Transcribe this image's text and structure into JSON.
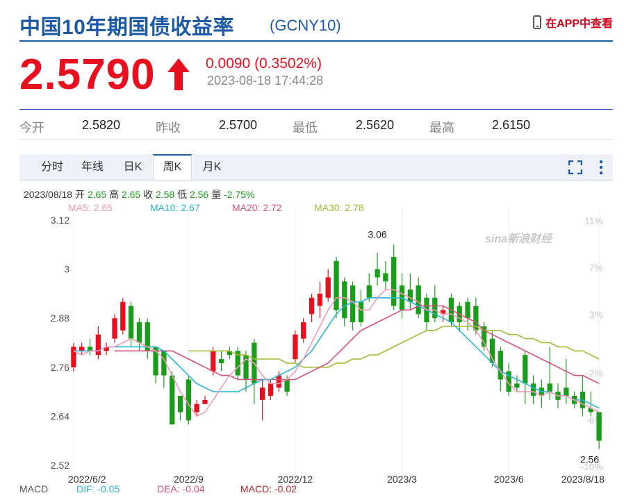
{
  "header": {
    "title": "中国10年期国债收益率",
    "code": "(GCNY10)",
    "app_link": "在APP中查看"
  },
  "quote": {
    "price": "2.5790",
    "change": "0.0090 (0.3502%)",
    "time": "2023-08-18 17:44:28"
  },
  "stats": [
    {
      "label": "今开",
      "value": "2.5820"
    },
    {
      "label": "昨收",
      "value": "2.5700"
    },
    {
      "label": "最低",
      "value": "2.5620"
    },
    {
      "label": "最高",
      "value": "2.6150"
    }
  ],
  "tabs": [
    {
      "label": "分时"
    },
    {
      "label": "年线"
    },
    {
      "label": "日K"
    },
    {
      "label": "周K",
      "active": true
    },
    {
      "label": "月K"
    }
  ],
  "info": {
    "date": "2023/08/18",
    "open_label": "开",
    "open": "2.65",
    "high_label": "高",
    "high": "2.65",
    "close_label": "收",
    "close": "2.58",
    "low_label": "低",
    "low": "2.56",
    "vol_label": "量",
    "change": "-2.75%"
  },
  "ma_legend": [
    {
      "text": "MA5: 2.65",
      "color": "#f09ab6"
    },
    {
      "text": "MA10: 2.67",
      "color": "#29b6d6"
    },
    {
      "text": "MA20: 2.72",
      "color": "#d84f7c"
    },
    {
      "text": "MA30: 2.78",
      "color": "#a6b833"
    }
  ],
  "macd": {
    "label": "MACD",
    "dif": "DIF: -0.05",
    "dea": "DEA: -0.04",
    "macd": "MACD: -0.02"
  },
  "watermark": "sina新浪财经",
  "colors": {
    "brand": "#1c5aa7",
    "up": "#e8101e",
    "down": "#1a9d1a"
  },
  "chart_data": {
    "type": "candlestick",
    "y_ticks": [
      "3.12",
      "3",
      "2.88",
      "2.76",
      "2.64",
      "2.52"
    ],
    "y_tick_values": [
      3.12,
      3.0,
      2.88,
      2.76,
      2.64,
      2.52
    ],
    "ylim": [
      2.52,
      3.12
    ],
    "pct_ticks": [
      "11%",
      "7%",
      "3%",
      "-2%",
      "-6%",
      "-10%"
    ],
    "pct_tick_values": [
      11,
      7,
      3,
      -2,
      -6,
      -10
    ],
    "x_labels": [
      {
        "i": 0,
        "label": "2022/6/2"
      },
      {
        "i": 14,
        "label": "2022/9"
      },
      {
        "i": 27,
        "label": "2022/12"
      },
      {
        "i": 40,
        "label": "2023/3"
      },
      {
        "i": 53,
        "label": "2023/6"
      },
      {
        "i": 64,
        "label": "2023/8/18"
      }
    ],
    "annotations": [
      {
        "i": 37,
        "value": 3.06,
        "label": "3.06",
        "pos": "above"
      },
      {
        "i": 64,
        "value": 2.56,
        "label": "2.56",
        "pos": "below"
      }
    ],
    "candles": [
      [
        2.76,
        2.81,
        2.82,
        2.75
      ],
      [
        2.8,
        2.81,
        2.82,
        2.79
      ],
      [
        2.81,
        2.8,
        2.83,
        2.79
      ],
      [
        2.79,
        2.84,
        2.86,
        2.78
      ],
      [
        2.8,
        2.81,
        2.82,
        2.79
      ],
      [
        2.83,
        2.88,
        2.89,
        2.82
      ],
      [
        2.85,
        2.92,
        2.93,
        2.84
      ],
      [
        2.91,
        2.83,
        2.92,
        2.81
      ],
      [
        2.87,
        2.82,
        2.88,
        2.8
      ],
      [
        2.87,
        2.8,
        2.88,
        2.78
      ],
      [
        2.81,
        2.74,
        2.81,
        2.72
      ],
      [
        2.8,
        2.74,
        2.8,
        2.71
      ],
      [
        2.74,
        2.62,
        2.75,
        2.62
      ],
      [
        2.69,
        2.65,
        2.69,
        2.63
      ],
      [
        2.73,
        2.63,
        2.74,
        2.62
      ],
      [
        2.65,
        2.67,
        2.68,
        2.64
      ],
      [
        2.67,
        2.68,
        2.69,
        2.67
      ],
      [
        2.75,
        2.8,
        2.81,
        2.74
      ],
      [
        2.78,
        2.77,
        2.8,
        2.75
      ],
      [
        2.8,
        2.79,
        2.81,
        2.78
      ],
      [
        2.8,
        2.74,
        2.81,
        2.73
      ],
      [
        2.79,
        2.73,
        2.8,
        2.7
      ],
      [
        2.82,
        2.72,
        2.83,
        2.67
      ],
      [
        2.68,
        2.71,
        2.73,
        2.63
      ],
      [
        2.69,
        2.72,
        2.73,
        2.68
      ],
      [
        2.71,
        2.74,
        2.75,
        2.7
      ],
      [
        2.73,
        2.7,
        2.74,
        2.69
      ],
      [
        2.78,
        2.84,
        2.85,
        2.77
      ],
      [
        2.83,
        2.87,
        2.88,
        2.82
      ],
      [
        2.89,
        2.93,
        2.94,
        2.87
      ],
      [
        2.91,
        2.94,
        2.97,
        2.88
      ],
      [
        2.93,
        2.98,
        3.0,
        2.92
      ],
      [
        3.02,
        2.9,
        3.03,
        2.88
      ],
      [
        2.97,
        2.88,
        2.98,
        2.86
      ],
      [
        2.96,
        2.87,
        2.97,
        2.85
      ],
      [
        2.92,
        2.87,
        2.95,
        2.86
      ],
      [
        2.96,
        2.93,
        2.99,
        2.92
      ],
      [
        3.0,
        2.98,
        3.04,
        2.96
      ],
      [
        2.99,
        2.97,
        3.02,
        2.95
      ],
      [
        3.03,
        2.91,
        3.06,
        2.9
      ],
      [
        2.96,
        2.9,
        2.99,
        2.88
      ],
      [
        2.95,
        2.92,
        2.99,
        2.9
      ],
      [
        2.96,
        2.89,
        2.98,
        2.88
      ],
      [
        2.93,
        2.87,
        2.94,
        2.85
      ],
      [
        2.93,
        2.88,
        2.96,
        2.87
      ],
      [
        2.89,
        2.9,
        2.91,
        2.87
      ],
      [
        2.93,
        2.87,
        2.94,
        2.86
      ],
      [
        2.91,
        2.87,
        2.92,
        2.85
      ],
      [
        2.92,
        2.88,
        2.93,
        2.85
      ],
      [
        2.91,
        2.85,
        2.93,
        2.84
      ],
      [
        2.86,
        2.81,
        2.87,
        2.8
      ],
      [
        2.83,
        2.77,
        2.85,
        2.76
      ],
      [
        2.8,
        2.73,
        2.81,
        2.7
      ],
      [
        2.75,
        2.7,
        2.77,
        2.69
      ],
      [
        2.72,
        2.71,
        2.74,
        2.7
      ],
      [
        2.79,
        2.72,
        2.8,
        2.67
      ],
      [
        2.72,
        2.69,
        2.74,
        2.67
      ],
      [
        2.71,
        2.69,
        2.73,
        2.66
      ],
      [
        2.72,
        2.7,
        2.81,
        2.68
      ],
      [
        2.7,
        2.68,
        2.72,
        2.66
      ],
      [
        2.71,
        2.69,
        2.78,
        2.67
      ],
      [
        2.69,
        2.67,
        2.7,
        2.66
      ],
      [
        2.7,
        2.66,
        2.74,
        2.64
      ],
      [
        2.66,
        2.65,
        2.7,
        2.64
      ],
      [
        2.65,
        2.58,
        2.65,
        2.56
      ]
    ],
    "ma5": [
      2.8,
      2.79,
      2.8,
      2.8,
      2.81,
      2.81,
      2.82,
      2.83,
      2.82,
      2.81,
      2.8,
      2.78,
      2.74,
      2.7,
      2.67,
      2.64,
      2.65,
      2.68,
      2.71,
      2.74,
      2.76,
      2.78,
      2.77,
      2.74,
      2.72,
      2.72,
      2.73,
      2.75,
      2.78,
      2.82,
      2.86,
      2.9,
      2.93,
      2.93,
      2.92,
      2.9,
      2.9,
      2.93,
      2.95,
      2.95,
      2.94,
      2.93,
      2.92,
      2.9,
      2.9,
      2.89,
      2.89,
      2.88,
      2.87,
      2.85,
      2.82,
      2.78,
      2.75,
      2.72,
      2.7,
      2.7,
      2.7,
      2.69,
      2.7,
      2.69,
      2.69,
      2.68,
      2.67,
      2.66,
      2.65
    ],
    "ma10": [
      2.8,
      2.8,
      2.8,
      2.8,
      2.81,
      2.81,
      2.81,
      2.81,
      2.81,
      2.81,
      2.81,
      2.8,
      2.78,
      2.76,
      2.74,
      2.72,
      2.71,
      2.7,
      2.7,
      2.7,
      2.7,
      2.71,
      2.72,
      2.73,
      2.73,
      2.74,
      2.75,
      2.76,
      2.78,
      2.8,
      2.83,
      2.86,
      2.89,
      2.91,
      2.92,
      2.92,
      2.93,
      2.93,
      2.93,
      2.93,
      2.93,
      2.92,
      2.91,
      2.9,
      2.89,
      2.88,
      2.87,
      2.85,
      2.83,
      2.81,
      2.79,
      2.77,
      2.75,
      2.74,
      2.73,
      2.72,
      2.71,
      2.7,
      2.7,
      2.69,
      2.69,
      2.68,
      2.68,
      2.67,
      2.66
    ],
    "ma20": [
      2.8,
      2.8,
      2.8,
      2.8,
      2.8,
      2.8,
      2.8,
      2.8,
      2.79,
      2.78,
      2.77,
      2.76,
      2.75,
      2.74,
      2.74,
      2.73,
      2.73,
      2.73,
      2.73,
      2.73,
      2.73,
      2.73,
      2.73,
      2.74,
      2.75,
      2.76,
      2.77,
      2.79,
      2.81,
      2.83,
      2.85,
      2.86,
      2.87,
      2.88,
      2.89,
      2.9,
      2.9,
      2.91,
      2.91,
      2.91,
      2.91,
      2.9,
      2.89,
      2.88,
      2.87,
      2.85,
      2.84,
      2.83,
      2.82,
      2.81,
      2.8,
      2.79,
      2.78,
      2.77,
      2.76,
      2.75,
      2.74,
      2.74,
      2.73,
      2.72
    ],
    "ma30": [
      2.8,
      2.8,
      2.8,
      2.8,
      2.8,
      2.8,
      2.79,
      2.79,
      2.78,
      2.78,
      2.78,
      2.78,
      2.77,
      2.77,
      2.76,
      2.76,
      2.76,
      2.76,
      2.77,
      2.77,
      2.78,
      2.78,
      2.79,
      2.79,
      2.8,
      2.81,
      2.82,
      2.83,
      2.84,
      2.85,
      2.85,
      2.86,
      2.86,
      2.86,
      2.86,
      2.86,
      2.85,
      2.85,
      2.85,
      2.84,
      2.84,
      2.83,
      2.83,
      2.82,
      2.82,
      2.81,
      2.81,
      2.8,
      2.8,
      2.79,
      2.78
    ]
  }
}
